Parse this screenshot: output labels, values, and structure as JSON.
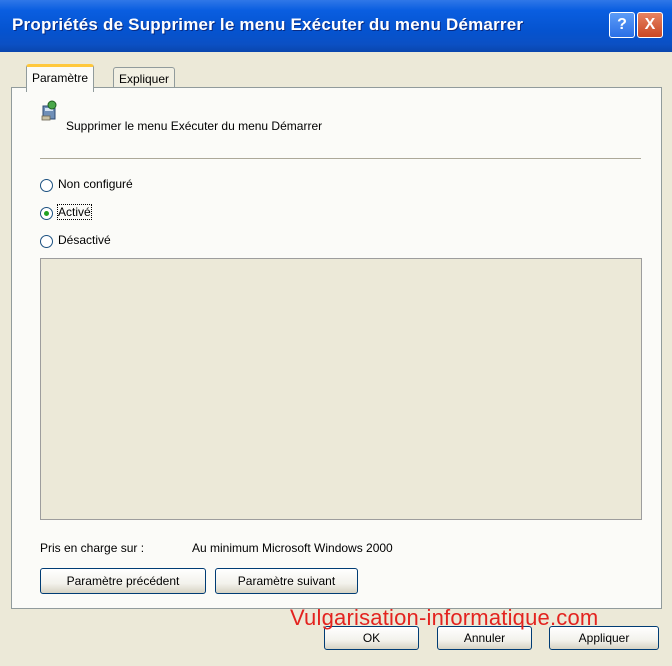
{
  "window": {
    "title": "Propriétés de Supprimer le menu Exécuter du menu Démarrer",
    "help_label": "?",
    "close_label": "X"
  },
  "tabs": [
    {
      "label": "Paramètre",
      "selected": true
    },
    {
      "label": "Expliquer",
      "selected": false
    }
  ],
  "policy": {
    "title": "Supprimer le menu Exécuter du menu Démarrer",
    "icon": "policy-setting-icon"
  },
  "radio_options": [
    {
      "label": "Non configuré",
      "checked": false
    },
    {
      "label": "Activé",
      "checked": true
    },
    {
      "label": "Désactivé",
      "checked": false
    }
  ],
  "supported": {
    "label": "Pris en charge sur :",
    "value": "Au minimum Microsoft Windows 2000"
  },
  "nav_buttons": {
    "previous": "Paramètre précédent",
    "next": "Paramètre suivant"
  },
  "dialog_buttons": {
    "ok": "OK",
    "cancel": "Annuler",
    "apply": "Appliquer"
  },
  "watermark": "Vulgarisation-informatique.com",
  "colors": {
    "titlebar": "#0553cf",
    "dialog_bg": "#ece9d8",
    "tab_highlight": "#ffc83c",
    "radio_dot": "#21a121",
    "watermark": "#e3231f"
  }
}
